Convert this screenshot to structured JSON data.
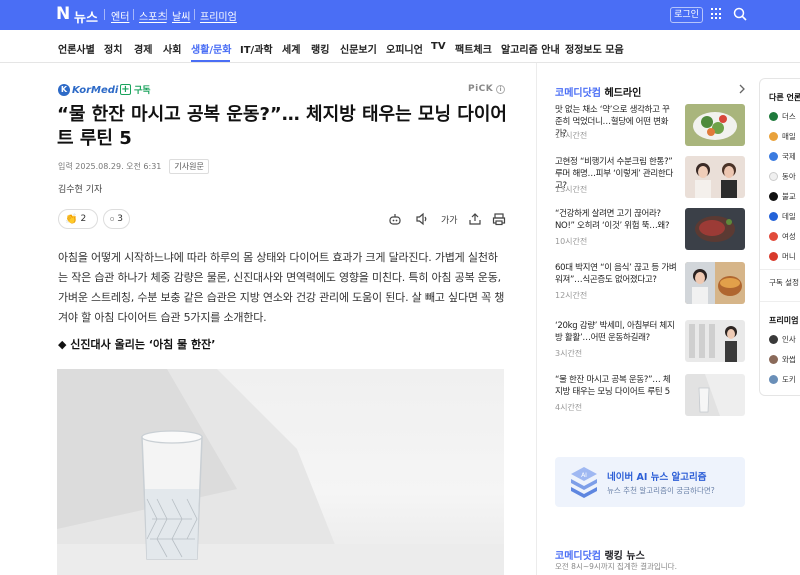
{
  "topbar": {
    "logo": "N",
    "brand": "뉴스",
    "links": [
      "엔터",
      "스포츠",
      "날씨",
      "프리미엄"
    ],
    "login": "로그인"
  },
  "nav": {
    "items": [
      "언론사별",
      "정치",
      "경제",
      "사회",
      "생활/문화",
      "IT/과학",
      "세계",
      "랭킹",
      "신문보기",
      "오피니언",
      "TV",
      "팩트체크",
      "알고리즘 안내",
      "정정보도 모음"
    ],
    "active": "생활/문화"
  },
  "article": {
    "press_logo": "KorMedi",
    "subscribe": "구독",
    "pick": "PiCK",
    "headline": "“물 한잔 마시고 공복 운동?”… 체지방 태우는 모닝 다이어트 루틴 5",
    "date": "입력 2025.08.29. 오전 6:31",
    "original_link": "기사원문",
    "reporter": "김수현 기자",
    "reaction_count": "2",
    "comment_count": "3",
    "font_tool": "가가",
    "body": "아침을 어떻게 시작하느냐에 따라 하루의 몸 상태와 다이어트 효과가 크게 달라진다. 가볍게 실천하는 작은 습관 하나가 체중 감량은 물론, 신진대사와 면역력에도 영향을 미친다. 특히 아침 공복 운동, 가벼운 스트레칭, 수분 보충 같은 습관은 지방 연소와 건강 관리에 도움이 된다. 살 빼고 싶다면 꼭 챙겨야 할 아침 다이어트 습관 5가지를 소개한다.",
    "subheading": "◆ 신진대사 올리는 ‘아침 물 한잔’"
  },
  "sidebar": {
    "headline_section": {
      "press": "코메디닷컴",
      "label": "헤드라인"
    },
    "items": [
      {
        "text": "맛 없는 채소 ‘약’으로 생각하고 꾸준히 먹었더니…혈당에 어떤 변화가?",
        "time": "14시간전"
      },
      {
        "text": "고현정 “비행기서 수분크림 한통?” 루머 해명…피부 ‘이렇게’ 관리한다고?",
        "time": "13시간전"
      },
      {
        "text": "“건강하게 살려면 고기 끊어라? NO!” 오히려 ‘이것’ 위험 뚝…왜?",
        "time": "10시간전"
      },
      {
        "text": "60대 박지연 “이 음식’ 끊고 등 가벼워져”…식곤증도 없어졌다고?",
        "time": "12시간전"
      },
      {
        "text": "‘20kg 감량’ 박세미, 아침부터 체지방 활활’…어떤 운동하길래?",
        "time": "3시간전"
      },
      {
        "text": "“물 한잔 마시고 공복 운동?”… 체지방 태우는 모닝 다이어트 루틴 5",
        "time": "4시간전"
      }
    ],
    "ai_box": {
      "title": "네이버 AI 뉴스 알고리즘",
      "subtitle": "뉴스 추천 알고리즘이 궁금하다면?",
      "badge": "AI"
    },
    "ranking": {
      "press": "코메디닷컴",
      "label": "랭킹 뉴스",
      "subtitle": "오전 8시~9시까지 집계한 결과입니다."
    }
  },
  "far_panel": {
    "title": "다른 언론사",
    "items": [
      "더스",
      "매일",
      "국제",
      "동아",
      "불교",
      "데일",
      "여성",
      "머니"
    ],
    "item_colors": [
      "#1f7a3c",
      "#e9a23b",
      "#3b7be0",
      "#f0f0f0",
      "#111111",
      "#2463d8",
      "#e14b3b",
      "#d83a2b"
    ],
    "subscribe_setting": "구독 설정",
    "premium_title": "프리미엄",
    "premium_items": [
      "인사",
      "와썹",
      "도키"
    ]
  },
  "colors": {
    "brand": "#4a6ef5",
    "press_green": "#1aa35c"
  }
}
